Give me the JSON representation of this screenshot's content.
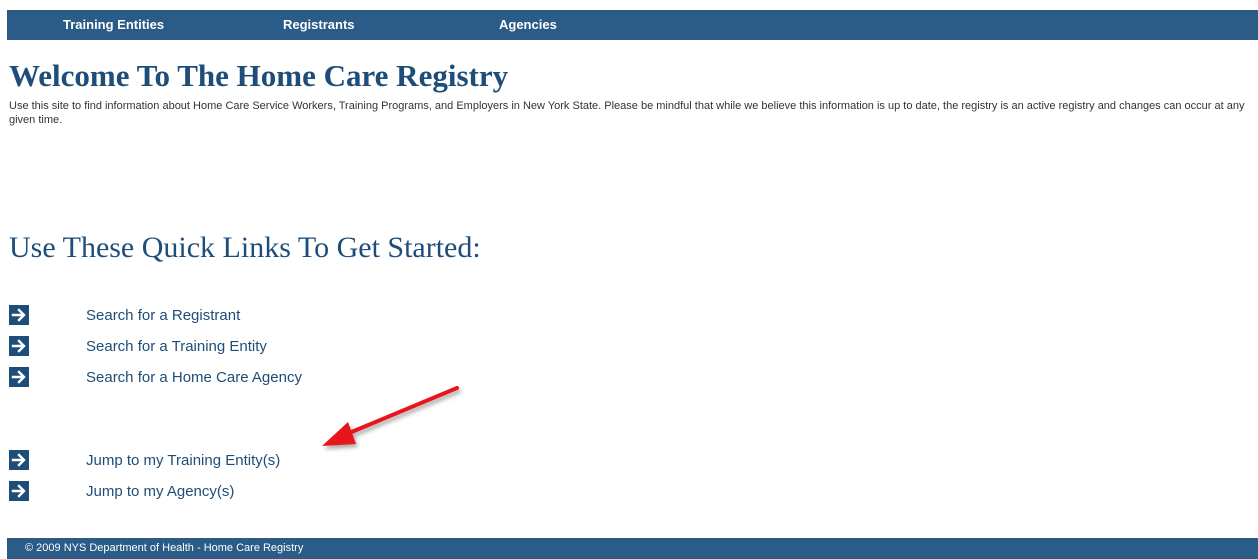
{
  "nav": {
    "training_entities": "Training Entities",
    "registrants": "Registrants",
    "agencies": "Agencies"
  },
  "header": {
    "title": "Welcome To The Home Care Registry",
    "intro": "Use this site to find information about Home Care Service Workers, Training Programs, and Employers in New York State. Please be mindful that while we believe this information is up to date, the registry is an active registry and changes can occur at any given time."
  },
  "quick_links": {
    "title": "Use These Quick Links To Get Started:",
    "items": [
      {
        "label": "Search for a Registrant",
        "icon": "arrow-right-icon"
      },
      {
        "label": "Search for a Training Entity",
        "icon": "arrow-right-icon"
      },
      {
        "label": "Search for a Home Care Agency",
        "icon": "arrow-right-icon"
      },
      {
        "label": "Jump to my Training Entity(s)",
        "icon": "arrow-right-icon"
      },
      {
        "label": "Jump to my Agency(s)",
        "icon": "arrow-right-icon"
      }
    ]
  },
  "footer": {
    "text": "© 2009 NYS Department of Health - Home Care Registry"
  },
  "colors": {
    "nav_bg": "#2b5b87",
    "title": "#1d4d78",
    "annotation_arrow": "#e8191b"
  }
}
